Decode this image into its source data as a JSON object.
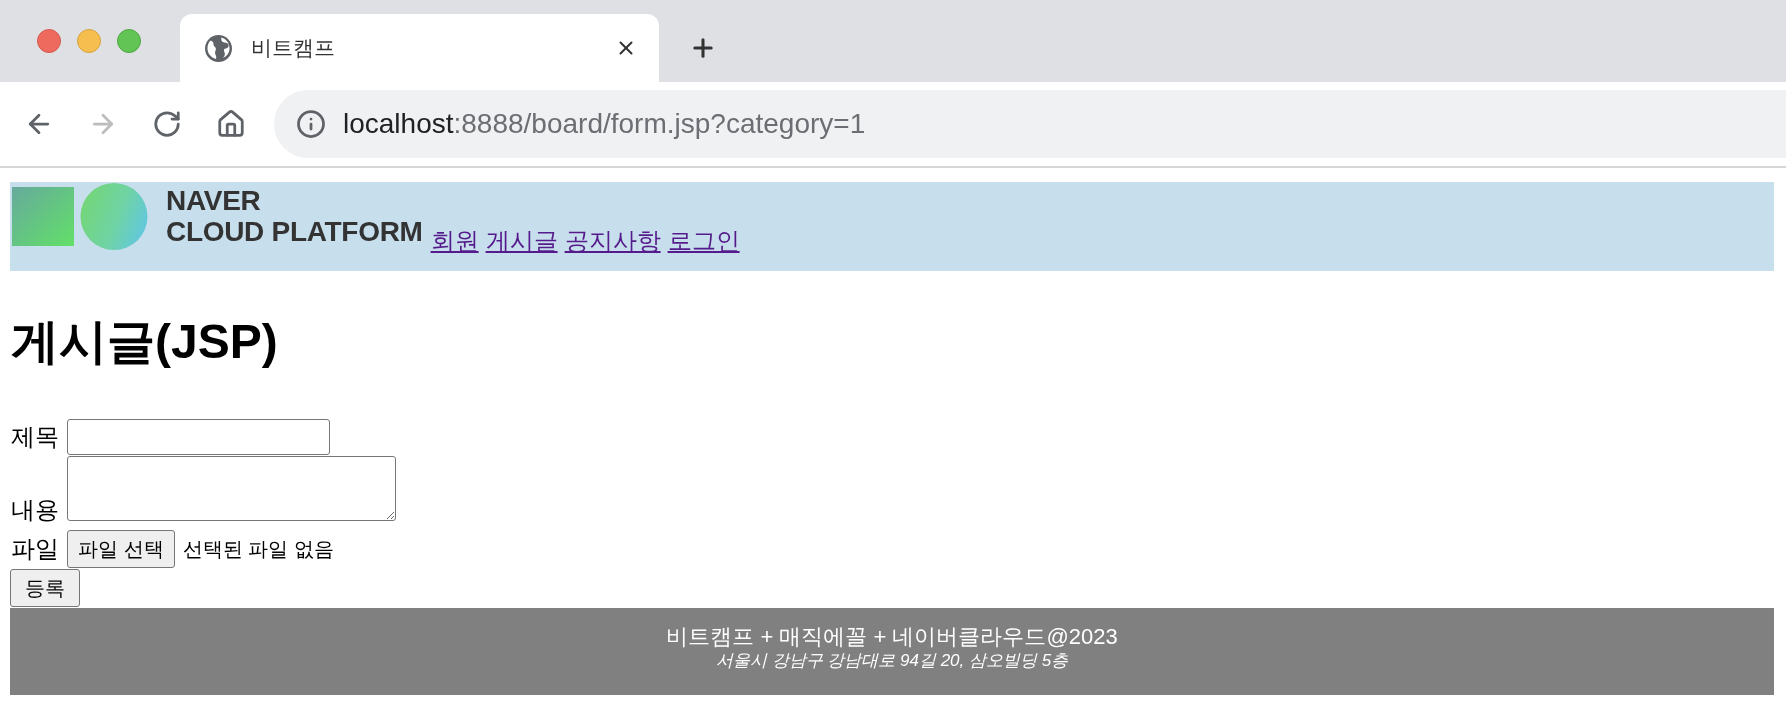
{
  "browser": {
    "tab": {
      "title": "비트캠프",
      "selected": true
    },
    "nav_buttons": [
      {
        "kind": "back",
        "disabled": false
      },
      {
        "kind": "forward",
        "disabled": true
      },
      {
        "kind": "reload",
        "disabled": false
      },
      {
        "kind": "home",
        "disabled": false
      }
    ],
    "address_bar": {
      "host": "localhost",
      "path": ":8888/board/form.jsp?category=1"
    }
  },
  "header": {
    "logo_text": [
      "NAVER",
      "CLOUD PLATFORM"
    ],
    "nav_links": [
      {
        "label": "회원",
        "visited": true
      },
      {
        "label": "게시글",
        "visited": true
      },
      {
        "label": "공지사항",
        "visited": true
      },
      {
        "label": "로그인",
        "visited": true
      }
    ]
  },
  "heading": "게시글(JSP)",
  "form": {
    "fields": [
      {
        "kind": "text",
        "label": "제목"
      },
      {
        "kind": "textarea",
        "label": "내용"
      },
      {
        "kind": "file",
        "label": "파일",
        "button": "파일 선택",
        "status": "선택된 파일 없음"
      }
    ],
    "submit": "등록"
  },
  "footer": {
    "line_1": "비트캠프 + 매직에꼴 + 네이버클라우드@2023",
    "line_2": "서울시 강남구 강남대로 94길 20, 삼오빌딩 5층"
  }
}
